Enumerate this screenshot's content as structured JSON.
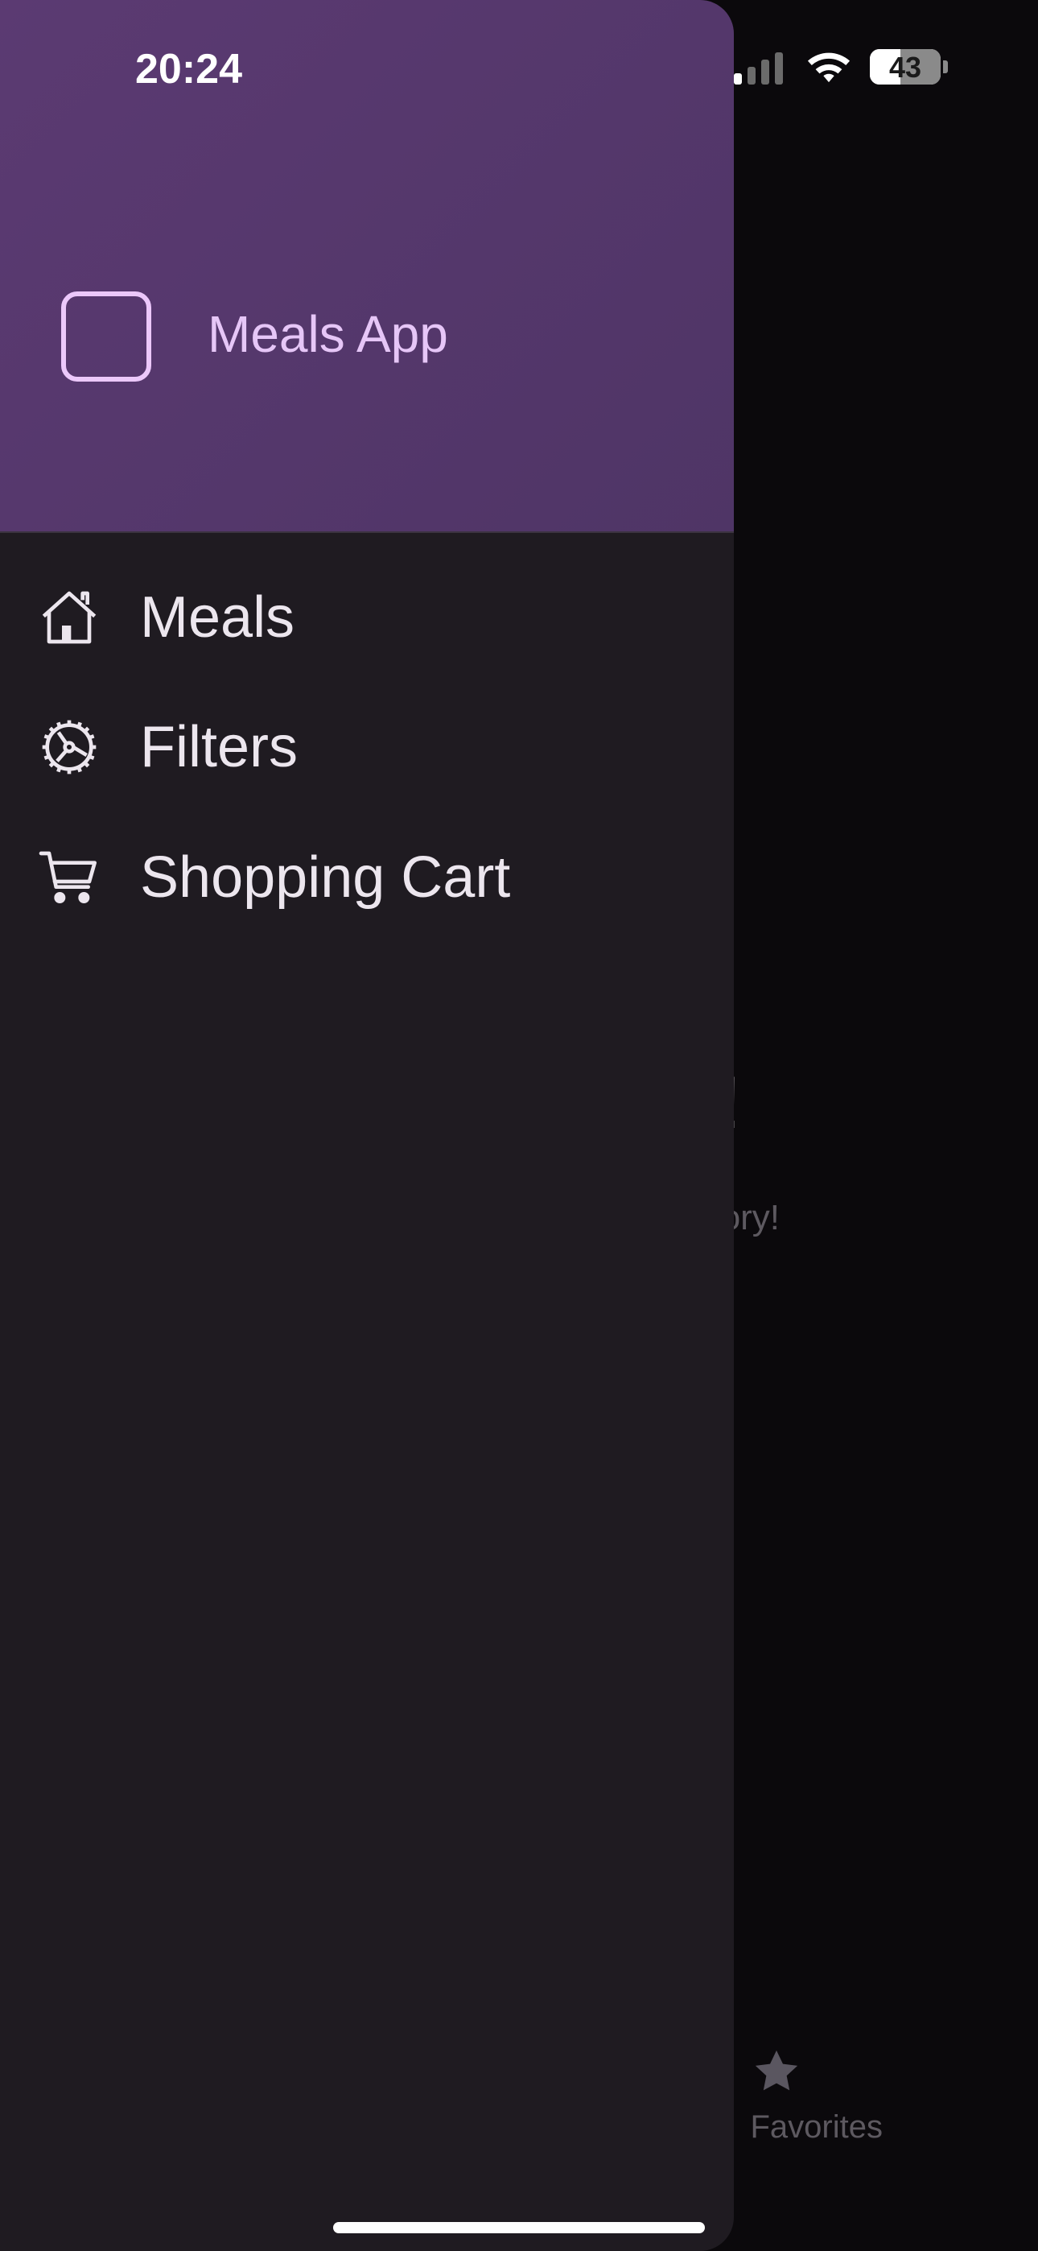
{
  "status_bar": {
    "time": "20:24",
    "battery": "43",
    "battery_level_percent": 43,
    "signal_bars_active": 1,
    "signal_bars_total": 4
  },
  "background_screen": {
    "title": "Nothing here!",
    "subtitle": "Try selecting a different category!",
    "tab_favorites_label": "Favorites",
    "tab_favorites_icon": "star-icon"
  },
  "drawer": {
    "header": {
      "logo_icon": "app-logo-square-icon",
      "title": "Meals App"
    },
    "items": [
      {
        "label": "Meals",
        "icon": "home-icon"
      },
      {
        "label": "Filters",
        "icon": "settings-gear-icon"
      },
      {
        "label": "Shopping Cart",
        "icon": "shopping-cart-icon"
      }
    ]
  },
  "colors": {
    "drawer_background": "#1f1b21",
    "header_background": "#56396d",
    "header_title": "#e6c6f7",
    "menu_text": "#ece6ee",
    "scrim": "#0b090c"
  }
}
